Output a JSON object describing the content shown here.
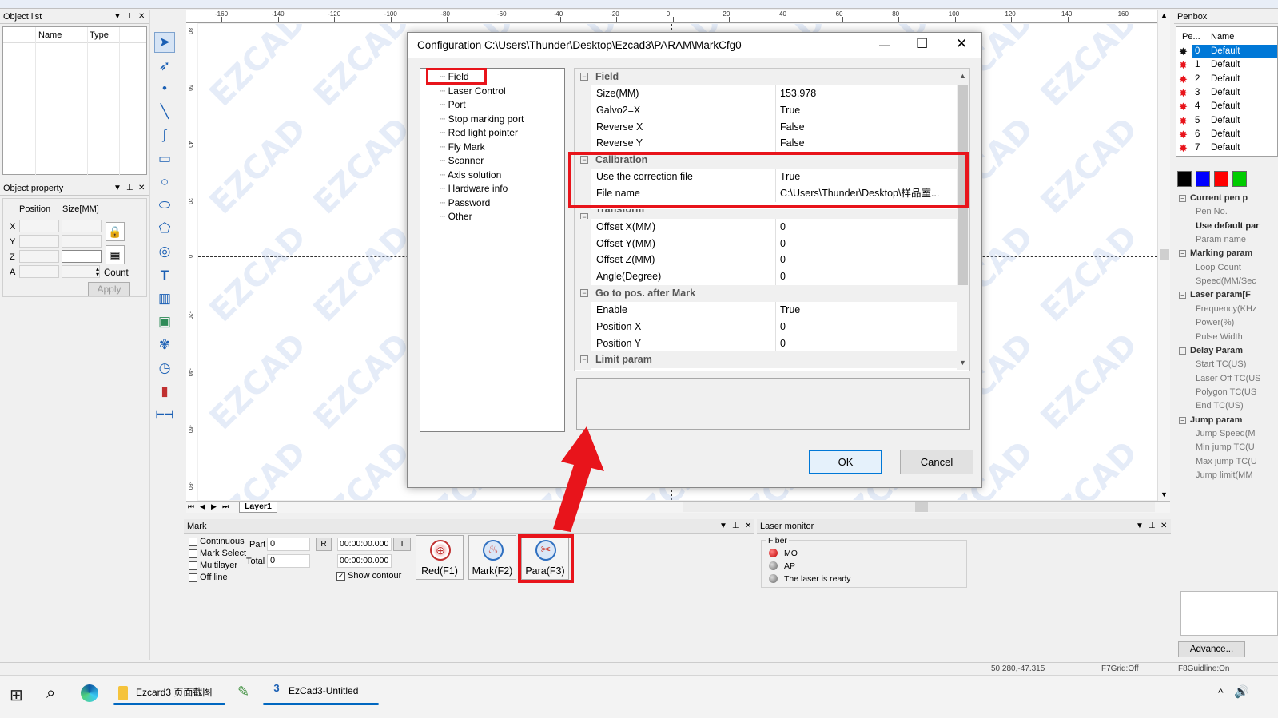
{
  "object_list": {
    "title": "Object list",
    "col_name": "Name",
    "col_type": "Type"
  },
  "object_property": {
    "title": "Object property",
    "position_label": "Position",
    "size_label": "Size[MM]",
    "axes": [
      "X",
      "Y",
      "Z",
      "A"
    ],
    "count_label": "Count",
    "apply_label": "Apply"
  },
  "ruler": {
    "top_ticks": [
      "-160",
      "-140",
      "-120",
      "-100",
      "-80",
      "-60",
      "-40",
      "-20",
      "0",
      "20",
      "40",
      "60",
      "80",
      "100",
      "120",
      "140",
      "160"
    ],
    "left_ticks": [
      "80",
      "60",
      "40",
      "20",
      "0",
      "-20",
      "-40",
      "-60",
      "-80"
    ]
  },
  "layer_tab": "Layer1",
  "dialog": {
    "title": "Configuration C:\\Users\\Thunder\\Desktop\\Ezcad3\\PARAM\\MarkCfg0",
    "tree": [
      "Field",
      "Laser Control",
      "Port",
      "Stop marking port",
      "Red light pointer",
      "Fly Mark",
      "Scanner",
      "Axis solution",
      "Hardware info",
      "Password",
      "Other"
    ],
    "sections": [
      {
        "name": "Field",
        "rows": [
          [
            "Size(MM)",
            "153.978"
          ],
          [
            "Galvo2=X",
            "True"
          ],
          [
            "Reverse X",
            "False"
          ],
          [
            "Reverse Y",
            "False"
          ]
        ]
      },
      {
        "name": "Calibration",
        "rows": [
          [
            "Use the correction file",
            "True"
          ],
          [
            "File name",
            "C:\\Users\\Thunder\\Desktop\\样品室..."
          ]
        ]
      },
      {
        "name": "Transform",
        "rows": [
          [
            "Offset X(MM)",
            "0"
          ],
          [
            "Offset Y(MM)",
            "0"
          ],
          [
            "Offset Z(MM)",
            "0"
          ],
          [
            "Angle(Degree)",
            "0"
          ]
        ]
      },
      {
        "name": "Go to pos. after Mark",
        "rows": [
          [
            "Enable",
            "True"
          ],
          [
            "Position X",
            "0"
          ],
          [
            "Position Y",
            "0"
          ]
        ]
      },
      {
        "name": "Limit param",
        "rows": []
      }
    ],
    "ok_label": "OK",
    "cancel_label": "Cancel"
  },
  "mark": {
    "title": "Mark",
    "checks": [
      "Continuous",
      "Mark Select",
      "Multilayer",
      "Off line"
    ],
    "part_label": "Part",
    "part_value": "0",
    "total_label": "Total",
    "total_value": "0",
    "r_label": "R",
    "t_label": "T",
    "time1": "00:00:00.000",
    "time2": "00:00:00.000",
    "show_contour": "Show contour",
    "red_label": "Red(F1)",
    "markf2_label": "Mark(F2)",
    "para_label": "Para(F3)"
  },
  "laser_monitor": {
    "title": "Laser monitor",
    "group": "Fiber",
    "items": [
      "MO",
      "AP",
      "The laser is ready"
    ]
  },
  "penbox": {
    "title": "Penbox",
    "col_pen": "Pe...",
    "col_name": "Name",
    "pens": [
      {
        "no": "0",
        "name": "Default"
      },
      {
        "no": "1",
        "name": "Default"
      },
      {
        "no": "2",
        "name": "Default"
      },
      {
        "no": "3",
        "name": "Default"
      },
      {
        "no": "4",
        "name": "Default"
      },
      {
        "no": "5",
        "name": "Default"
      },
      {
        "no": "6",
        "name": "Default"
      },
      {
        "no": "7",
        "name": "Default"
      }
    ],
    "colors": [
      "#000000",
      "#0000ff",
      "#ff0000",
      "#00cc00"
    ],
    "params": [
      {
        "cat": "Current pen p"
      },
      {
        "item": "Pen No."
      },
      {
        "item": "Use default par"
      },
      {
        "item": "Param name"
      },
      {
        "cat": "Marking param"
      },
      {
        "item": "Loop Count"
      },
      {
        "item": "Speed(MM/Sec"
      },
      {
        "cat": "Laser param[F"
      },
      {
        "item": "Frequency(KHz"
      },
      {
        "item": "Power(%)"
      },
      {
        "item": "Pulse Width"
      },
      {
        "cat": "Delay Param"
      },
      {
        "item": "Start TC(US)"
      },
      {
        "item": "Laser Off TC(US"
      },
      {
        "item": "Polygon TC(US"
      },
      {
        "item": "End TC(US)"
      },
      {
        "cat": "Jump param"
      },
      {
        "item": "Jump Speed(M"
      },
      {
        "item": "Min jump TC(U"
      },
      {
        "item": "Max jump TC(U"
      },
      {
        "item": "Jump limit(MM"
      }
    ],
    "advance_label": "Advance..."
  },
  "status": {
    "coords": "50.280,-47.315",
    "grid": "F7Grid:Off",
    "guide": "F8Guidline:On"
  },
  "watermark": "EZCAD",
  "taskbar": {
    "app1": "Ezcard3 页面截图",
    "app2": "EzCad3-Untitled"
  },
  "highlight_color": "#e8141b"
}
